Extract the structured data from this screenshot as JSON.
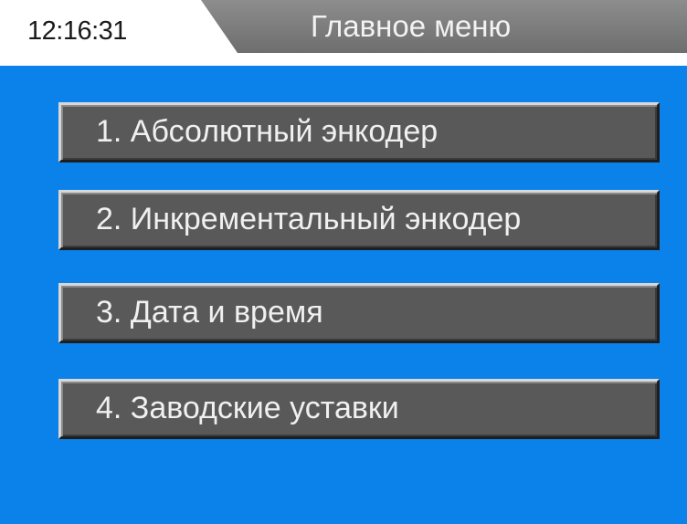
{
  "header": {
    "time": "12:16:31",
    "title": "Главное меню"
  },
  "menu": {
    "items": [
      {
        "label": "1. Абсолютный энкодер"
      },
      {
        "label": "2. Инкрементальный энкодер"
      },
      {
        "label": "3. Дата и время"
      },
      {
        "label": "4. Заводские уставки"
      }
    ]
  },
  "colors": {
    "background": "#0a82e9",
    "button": "#595959",
    "title_bar": "#7d7d7d"
  }
}
